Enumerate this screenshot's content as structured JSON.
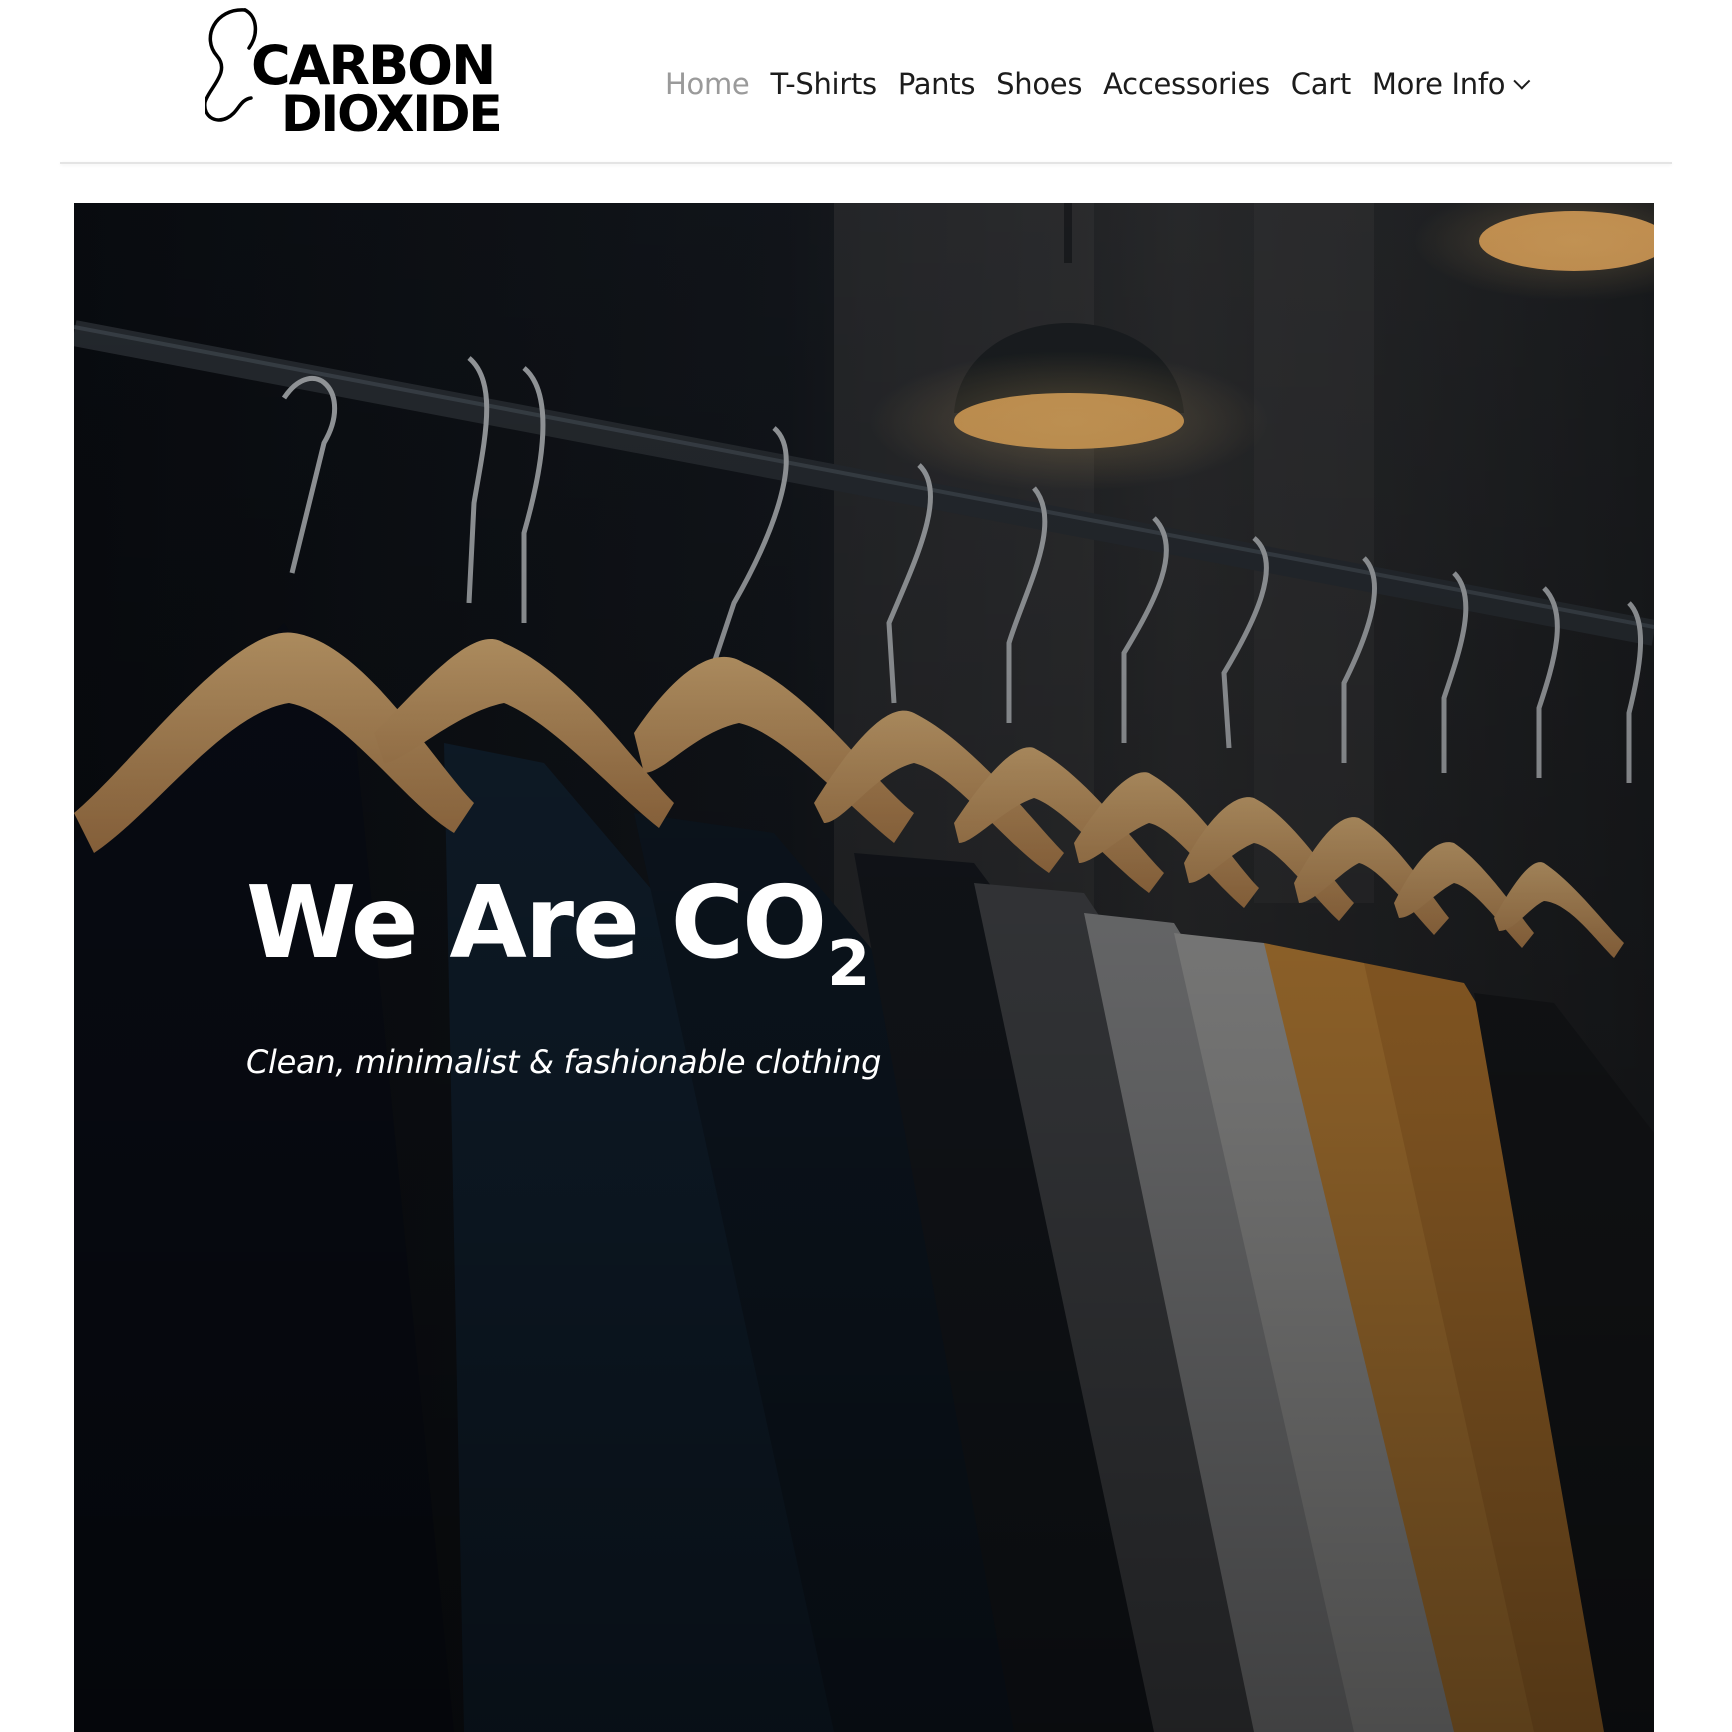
{
  "brand": {
    "logo_line1": "CARBON",
    "logo_line2": "DIOXIDE",
    "logo_alt": "Carbon Dioxide logo"
  },
  "nav": {
    "items": [
      {
        "label": "Home",
        "active": true
      },
      {
        "label": "T-Shirts",
        "active": false
      },
      {
        "label": "Pants",
        "active": false
      },
      {
        "label": "Shoes",
        "active": false
      },
      {
        "label": "Accessories",
        "active": false
      },
      {
        "label": "Cart",
        "active": false
      }
    ],
    "more_label": "More Info",
    "more_icon": "chevron-down-icon",
    "active_color": "#9a9a9a",
    "text_color": "#1c1c1c"
  },
  "hero": {
    "title": "We Are CO",
    "title_subscript": "2",
    "tagline": "Clean, minimalist & fashionable clothing",
    "image_description_icon": "hero-image",
    "overlay_color": "#0b0f17"
  }
}
